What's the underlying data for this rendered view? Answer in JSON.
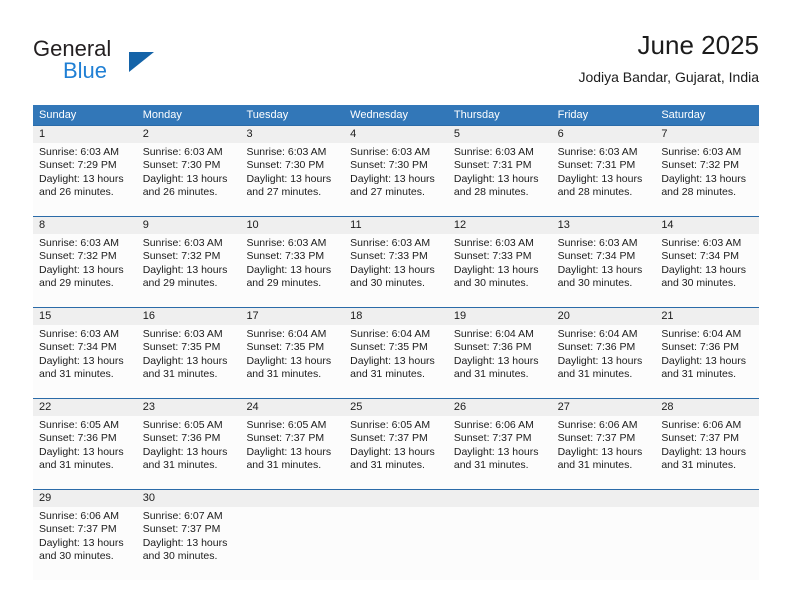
{
  "brand": {
    "name_part1": "General",
    "name_part2": "Blue",
    "triangle_color": "#1463a8",
    "blue_color": "#1f7fd4"
  },
  "header": {
    "title": "June 2025",
    "subtitle": "Jodiya Bandar, Gujarat, India"
  },
  "theme": {
    "header_bg": "#3277b8",
    "week_divider": "#2b6ba8",
    "date_band_bg": "#efefef",
    "cell_bg": "#fcfcfc"
  },
  "weekdays": [
    "Sunday",
    "Monday",
    "Tuesday",
    "Wednesday",
    "Thursday",
    "Friday",
    "Saturday"
  ],
  "weeks": [
    {
      "days": [
        {
          "date": "1",
          "sunrise": "Sunrise: 6:03 AM",
          "sunset": "Sunset: 7:29 PM",
          "daylight1": "Daylight: 13 hours",
          "daylight2": "and 26 minutes."
        },
        {
          "date": "2",
          "sunrise": "Sunrise: 6:03 AM",
          "sunset": "Sunset: 7:30 PM",
          "daylight1": "Daylight: 13 hours",
          "daylight2": "and 26 minutes."
        },
        {
          "date": "3",
          "sunrise": "Sunrise: 6:03 AM",
          "sunset": "Sunset: 7:30 PM",
          "daylight1": "Daylight: 13 hours",
          "daylight2": "and 27 minutes."
        },
        {
          "date": "4",
          "sunrise": "Sunrise: 6:03 AM",
          "sunset": "Sunset: 7:30 PM",
          "daylight1": "Daylight: 13 hours",
          "daylight2": "and 27 minutes."
        },
        {
          "date": "5",
          "sunrise": "Sunrise: 6:03 AM",
          "sunset": "Sunset: 7:31 PM",
          "daylight1": "Daylight: 13 hours",
          "daylight2": "and 28 minutes."
        },
        {
          "date": "6",
          "sunrise": "Sunrise: 6:03 AM",
          "sunset": "Sunset: 7:31 PM",
          "daylight1": "Daylight: 13 hours",
          "daylight2": "and 28 minutes."
        },
        {
          "date": "7",
          "sunrise": "Sunrise: 6:03 AM",
          "sunset": "Sunset: 7:32 PM",
          "daylight1": "Daylight: 13 hours",
          "daylight2": "and 28 minutes."
        }
      ]
    },
    {
      "days": [
        {
          "date": "8",
          "sunrise": "Sunrise: 6:03 AM",
          "sunset": "Sunset: 7:32 PM",
          "daylight1": "Daylight: 13 hours",
          "daylight2": "and 29 minutes."
        },
        {
          "date": "9",
          "sunrise": "Sunrise: 6:03 AM",
          "sunset": "Sunset: 7:32 PM",
          "daylight1": "Daylight: 13 hours",
          "daylight2": "and 29 minutes."
        },
        {
          "date": "10",
          "sunrise": "Sunrise: 6:03 AM",
          "sunset": "Sunset: 7:33 PM",
          "daylight1": "Daylight: 13 hours",
          "daylight2": "and 29 minutes."
        },
        {
          "date": "11",
          "sunrise": "Sunrise: 6:03 AM",
          "sunset": "Sunset: 7:33 PM",
          "daylight1": "Daylight: 13 hours",
          "daylight2": "and 30 minutes."
        },
        {
          "date": "12",
          "sunrise": "Sunrise: 6:03 AM",
          "sunset": "Sunset: 7:33 PM",
          "daylight1": "Daylight: 13 hours",
          "daylight2": "and 30 minutes."
        },
        {
          "date": "13",
          "sunrise": "Sunrise: 6:03 AM",
          "sunset": "Sunset: 7:34 PM",
          "daylight1": "Daylight: 13 hours",
          "daylight2": "and 30 minutes."
        },
        {
          "date": "14",
          "sunrise": "Sunrise: 6:03 AM",
          "sunset": "Sunset: 7:34 PM",
          "daylight1": "Daylight: 13 hours",
          "daylight2": "and 30 minutes."
        }
      ]
    },
    {
      "days": [
        {
          "date": "15",
          "sunrise": "Sunrise: 6:03 AM",
          "sunset": "Sunset: 7:34 PM",
          "daylight1": "Daylight: 13 hours",
          "daylight2": "and 31 minutes."
        },
        {
          "date": "16",
          "sunrise": "Sunrise: 6:03 AM",
          "sunset": "Sunset: 7:35 PM",
          "daylight1": "Daylight: 13 hours",
          "daylight2": "and 31 minutes."
        },
        {
          "date": "17",
          "sunrise": "Sunrise: 6:04 AM",
          "sunset": "Sunset: 7:35 PM",
          "daylight1": "Daylight: 13 hours",
          "daylight2": "and 31 minutes."
        },
        {
          "date": "18",
          "sunrise": "Sunrise: 6:04 AM",
          "sunset": "Sunset: 7:35 PM",
          "daylight1": "Daylight: 13 hours",
          "daylight2": "and 31 minutes."
        },
        {
          "date": "19",
          "sunrise": "Sunrise: 6:04 AM",
          "sunset": "Sunset: 7:36 PM",
          "daylight1": "Daylight: 13 hours",
          "daylight2": "and 31 minutes."
        },
        {
          "date": "20",
          "sunrise": "Sunrise: 6:04 AM",
          "sunset": "Sunset: 7:36 PM",
          "daylight1": "Daylight: 13 hours",
          "daylight2": "and 31 minutes."
        },
        {
          "date": "21",
          "sunrise": "Sunrise: 6:04 AM",
          "sunset": "Sunset: 7:36 PM",
          "daylight1": "Daylight: 13 hours",
          "daylight2": "and 31 minutes."
        }
      ]
    },
    {
      "days": [
        {
          "date": "22",
          "sunrise": "Sunrise: 6:05 AM",
          "sunset": "Sunset: 7:36 PM",
          "daylight1": "Daylight: 13 hours",
          "daylight2": "and 31 minutes."
        },
        {
          "date": "23",
          "sunrise": "Sunrise: 6:05 AM",
          "sunset": "Sunset: 7:36 PM",
          "daylight1": "Daylight: 13 hours",
          "daylight2": "and 31 minutes."
        },
        {
          "date": "24",
          "sunrise": "Sunrise: 6:05 AM",
          "sunset": "Sunset: 7:37 PM",
          "daylight1": "Daylight: 13 hours",
          "daylight2": "and 31 minutes."
        },
        {
          "date": "25",
          "sunrise": "Sunrise: 6:05 AM",
          "sunset": "Sunset: 7:37 PM",
          "daylight1": "Daylight: 13 hours",
          "daylight2": "and 31 minutes."
        },
        {
          "date": "26",
          "sunrise": "Sunrise: 6:06 AM",
          "sunset": "Sunset: 7:37 PM",
          "daylight1": "Daylight: 13 hours",
          "daylight2": "and 31 minutes."
        },
        {
          "date": "27",
          "sunrise": "Sunrise: 6:06 AM",
          "sunset": "Sunset: 7:37 PM",
          "daylight1": "Daylight: 13 hours",
          "daylight2": "and 31 minutes."
        },
        {
          "date": "28",
          "sunrise": "Sunrise: 6:06 AM",
          "sunset": "Sunset: 7:37 PM",
          "daylight1": "Daylight: 13 hours",
          "daylight2": "and 31 minutes."
        }
      ]
    },
    {
      "days": [
        {
          "date": "29",
          "sunrise": "Sunrise: 6:06 AM",
          "sunset": "Sunset: 7:37 PM",
          "daylight1": "Daylight: 13 hours",
          "daylight2": "and 30 minutes."
        },
        {
          "date": "30",
          "sunrise": "Sunrise: 6:07 AM",
          "sunset": "Sunset: 7:37 PM",
          "daylight1": "Daylight: 13 hours",
          "daylight2": "and 30 minutes."
        },
        {
          "date": "",
          "sunrise": "",
          "sunset": "",
          "daylight1": "",
          "daylight2": ""
        },
        {
          "date": "",
          "sunrise": "",
          "sunset": "",
          "daylight1": "",
          "daylight2": ""
        },
        {
          "date": "",
          "sunrise": "",
          "sunset": "",
          "daylight1": "",
          "daylight2": ""
        },
        {
          "date": "",
          "sunrise": "",
          "sunset": "",
          "daylight1": "",
          "daylight2": ""
        },
        {
          "date": "",
          "sunrise": "",
          "sunset": "",
          "daylight1": "",
          "daylight2": ""
        }
      ]
    }
  ]
}
